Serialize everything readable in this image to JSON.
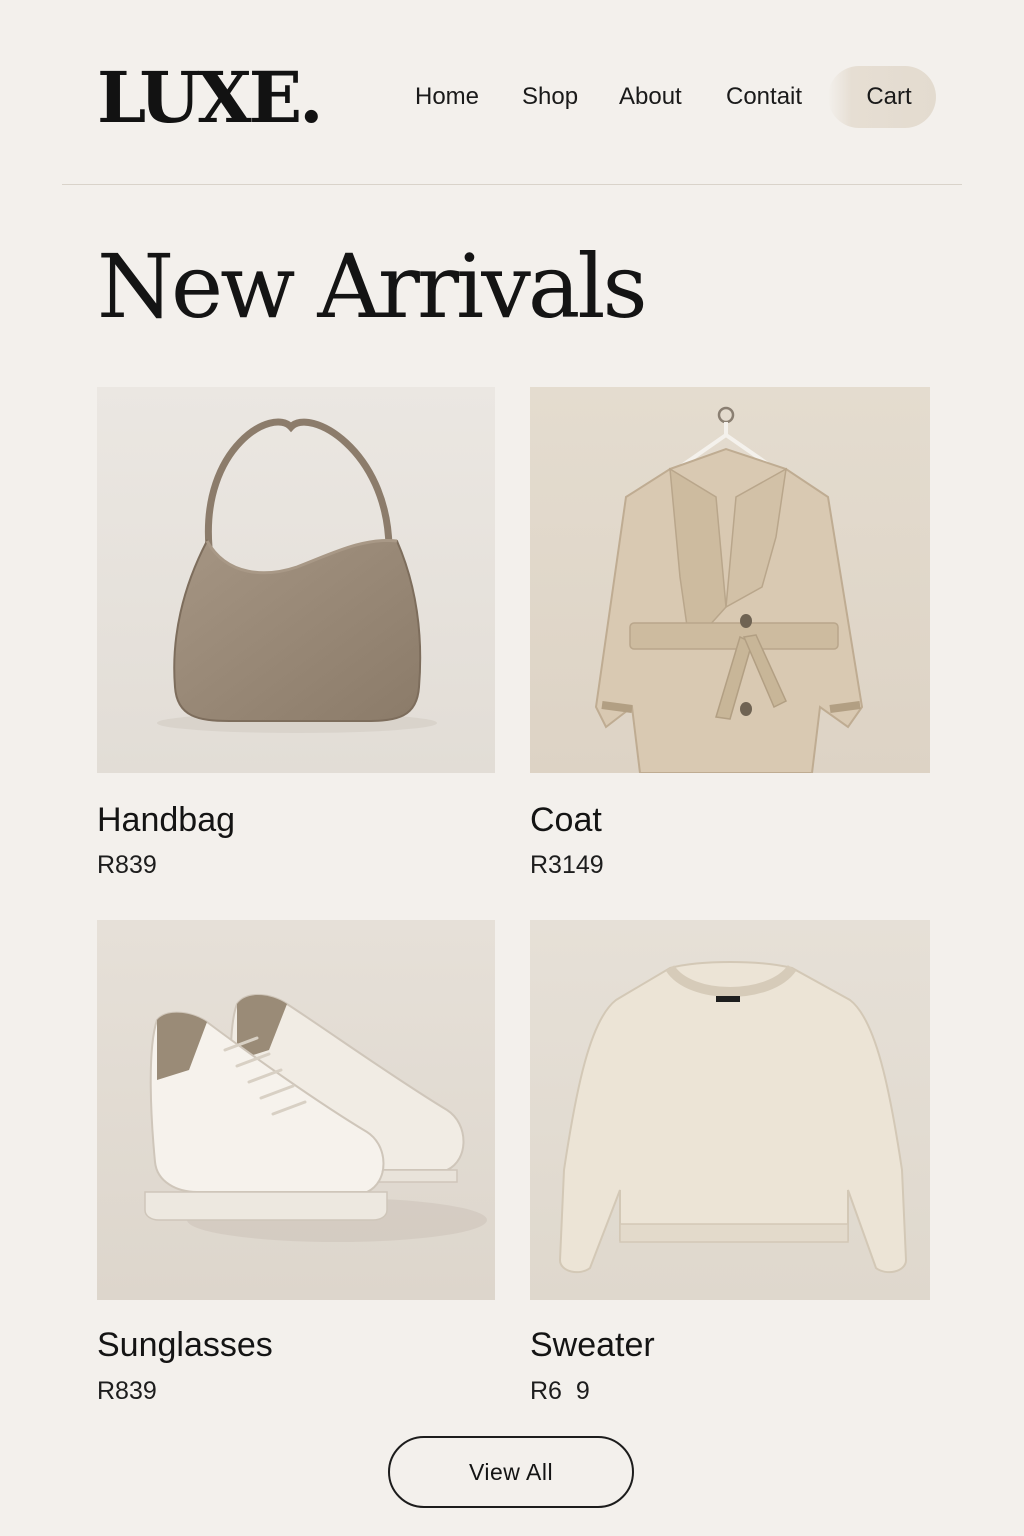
{
  "header": {
    "logo": "LUXE.",
    "nav": {
      "home": "Home",
      "shop": "Shop",
      "about": "About",
      "contact": "Contait",
      "cart": "Cart"
    }
  },
  "main": {
    "title": "New Arrivals",
    "products": [
      {
        "name": "Handbag",
        "price": "R839",
        "image_icon": "handbag-icon"
      },
      {
        "name": "Coat",
        "price": "R3149",
        "image_icon": "coat-icon"
      },
      {
        "name": "Sunglasses",
        "price": "R839",
        "image_icon": "sneakers-icon"
      },
      {
        "name": "Sweater",
        "price": "R6  9",
        "image_icon": "sweater-icon"
      }
    ],
    "view_all": "View All"
  },
  "colors": {
    "background": "#f3f0ec",
    "text": "#141414",
    "cart_pill": "#e3dbcf",
    "image_bg": "#e7e2dc"
  }
}
